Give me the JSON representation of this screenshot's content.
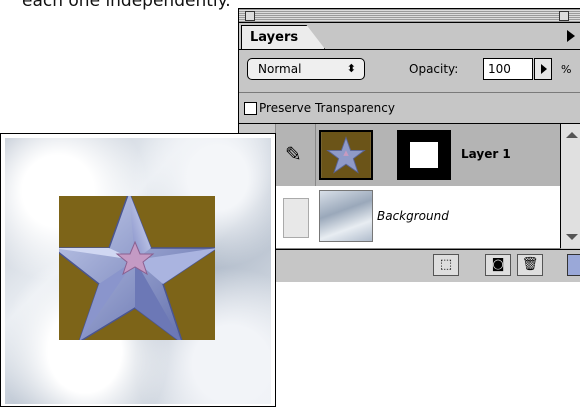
{
  "caption": "each one independently.",
  "layers_palette": {
    "tab_label": "Layers",
    "blend_mode": "Normal",
    "opacity_label": "Opacity:",
    "opacity_value": "100",
    "percent_sign": "%",
    "preserve_transparency_label": "Preserve Transparency",
    "preserve_transparency_checked": false,
    "layers": [
      {
        "name": "Layer 1",
        "selected": true,
        "has_mask": true
      },
      {
        "name": "Background",
        "selected": false,
        "has_mask": false
      }
    ],
    "bottom_buttons": [
      "mask-icon",
      "new-layer-icon",
      "trash-icon"
    ]
  },
  "colors": {
    "palette_bg": "#c6c6c6",
    "selected_row": "#b4b4b4",
    "gold": "#7d6418"
  }
}
